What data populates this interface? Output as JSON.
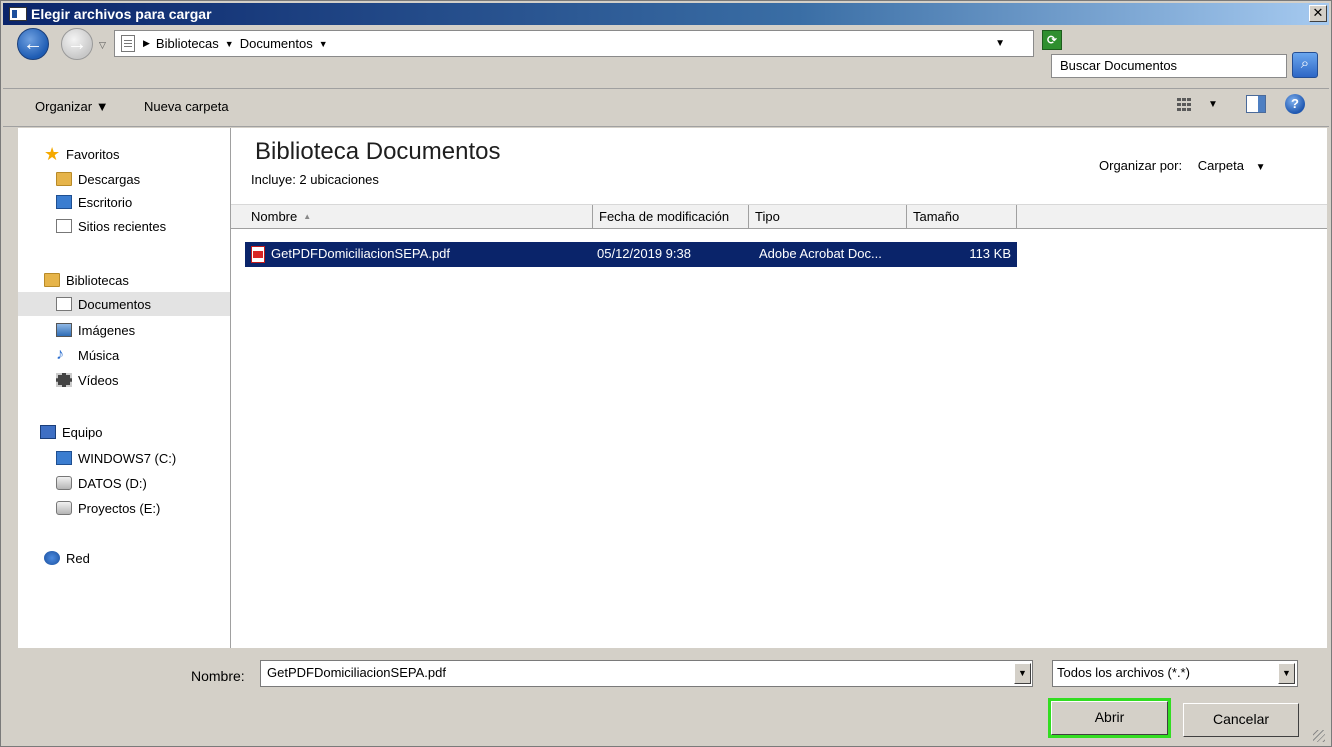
{
  "window": {
    "title": "Elegir archivos para cargar",
    "close_glyph": "✕"
  },
  "address": {
    "crumbs": [
      "Bibliotecas",
      "Documentos"
    ],
    "search_text": "Buscar Documentos"
  },
  "toolbar": {
    "organize": "Organizar ▼",
    "new_folder": "Nueva carpeta"
  },
  "nav": {
    "items": [
      {
        "label": "Favoritos",
        "icon": "star-icon"
      },
      {
        "label": "Descargas",
        "icon": "downloads-icon"
      },
      {
        "label": "Escritorio",
        "icon": "desktop-icon"
      },
      {
        "label": "Sitios recientes",
        "icon": "recent-places-icon"
      },
      {
        "label": "Bibliotecas",
        "icon": "libraries-icon"
      },
      {
        "label": "Documentos",
        "icon": "documents-icon"
      },
      {
        "label": "Imágenes",
        "icon": "pictures-icon"
      },
      {
        "label": "Música",
        "icon": "music-icon"
      },
      {
        "label": "Vídeos",
        "icon": "videos-icon"
      },
      {
        "label": "Equipo",
        "icon": "computer-icon"
      },
      {
        "label": "WINDOWS7 (C:)",
        "icon": "system-drive-icon"
      },
      {
        "label": "DATOS (D:)",
        "icon": "drive-icon"
      },
      {
        "label": "Proyectos (E:)",
        "icon": "drive-icon"
      },
      {
        "label": "Red",
        "icon": "network-icon"
      }
    ],
    "selected": "Documentos"
  },
  "content": {
    "library_title": "Biblioteca Documentos",
    "library_subtitle": "Incluye:  2 ubicaciones",
    "arrange_label": "Organizar por:",
    "arrange_value": "Carpeta",
    "columns": [
      "Nombre",
      "Fecha de modificación",
      "Tipo",
      "Tamaño"
    ],
    "files": [
      {
        "name": "GetPDFDomiciliacionSEPA.pdf",
        "modified": "05/12/2019  9:38",
        "type": "Adobe Acrobat Doc...",
        "size": "113 KB",
        "selected": true
      }
    ]
  },
  "bottom": {
    "filename_label": "Nombre:",
    "filename_value": "GetPDFDomiciliacionSEPA.pdf",
    "filter_value": "Todos los archivos (*.*)",
    "open_label": "Abrir",
    "cancel_label": "Cancelar"
  },
  "colors": {
    "selection": "#0a246a",
    "highlight": "#33dd22",
    "chrome": "#d4d0c8"
  }
}
